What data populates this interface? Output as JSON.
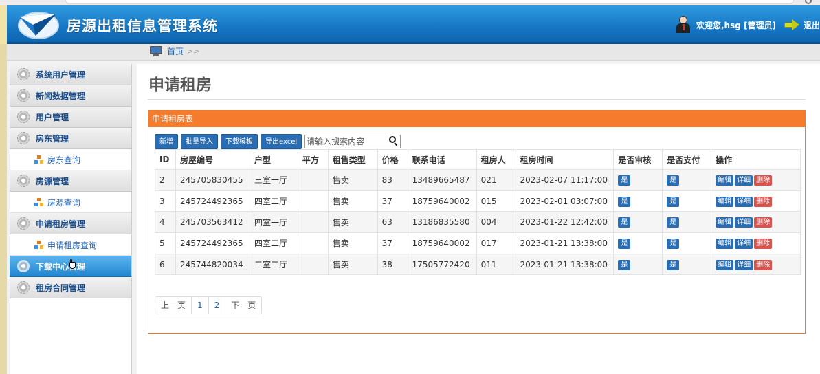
{
  "app": {
    "title": "房源出租信息管理系统"
  },
  "header": {
    "welcome": "欢迎您,hsg [管理员]",
    "logout_label": "退出"
  },
  "breadcrumb": {
    "home": "首页",
    "separator": ">>"
  },
  "sidebar": {
    "items": [
      {
        "label": "系统用户管理",
        "type": "menu"
      },
      {
        "label": "新闻数据管理",
        "type": "menu"
      },
      {
        "label": "用户管理",
        "type": "menu"
      },
      {
        "label": "房东管理",
        "type": "menu"
      },
      {
        "label": "房东查询",
        "type": "sub"
      },
      {
        "label": "房源管理",
        "type": "menu"
      },
      {
        "label": "房源查询",
        "type": "sub"
      },
      {
        "label": "申请租房管理",
        "type": "menu"
      },
      {
        "label": "申请租房查询",
        "type": "sub"
      },
      {
        "label": "下载中心管理",
        "type": "menu",
        "active": true
      },
      {
        "label": "租房合同管理",
        "type": "menu"
      }
    ]
  },
  "main": {
    "page_title": "申请租房",
    "panel_title": "申请租房表",
    "toolbar": {
      "add": "新增",
      "batch_import": "批量导入",
      "download_template": "下载模板",
      "export_excel": "导出excel",
      "search_placeholder": "请输入搜索内容"
    },
    "table": {
      "columns": [
        "ID",
        "房屋编号",
        "户型",
        "平方",
        "租售类型",
        "价格",
        "联系电话",
        "租房人",
        "租房时间",
        "是否审核",
        "是否支付",
        "操作"
      ],
      "rows": [
        {
          "id": "2",
          "house_no": "245705830455",
          "layout": "三室一厅",
          "area": "",
          "type": "售卖",
          "price": "83",
          "phone": "13489665487",
          "renter": "021",
          "time": "2023-02-07 11:17:00",
          "audited": "是",
          "paid": "是"
        },
        {
          "id": "3",
          "house_no": "245724492365",
          "layout": "四室二厅",
          "area": "",
          "type": "售卖",
          "price": "37",
          "phone": "18759640002",
          "renter": "015",
          "time": "2023-02-01 03:07:00",
          "audited": "是",
          "paid": "是"
        },
        {
          "id": "4",
          "house_no": "245703563412",
          "layout": "四室一厅",
          "area": "",
          "type": "售卖",
          "price": "63",
          "phone": "13186835580",
          "renter": "004",
          "time": "2023-01-22 12:42:00",
          "audited": "是",
          "paid": "是"
        },
        {
          "id": "5",
          "house_no": "245724492365",
          "layout": "四室二厅",
          "area": "",
          "type": "售卖",
          "price": "37",
          "phone": "18759640002",
          "renter": "017",
          "time": "2023-01-21 13:38:00",
          "audited": "是",
          "paid": "是"
        },
        {
          "id": "6",
          "house_no": "245744820034",
          "layout": "二室二厅",
          "area": "",
          "type": "售卖",
          "price": "38",
          "phone": "17505772420",
          "renter": "011",
          "time": "2023-01-21 13:38:00",
          "audited": "是",
          "paid": "是"
        }
      ],
      "actions": {
        "edit": "编辑",
        "detail": "详细",
        "delete": "删除"
      }
    },
    "pager": {
      "prev": "上一页",
      "pages": [
        "1",
        "2"
      ],
      "next": "下一页"
    }
  },
  "colors": {
    "header_blue": "#1676c4",
    "panel_orange": "#f47c2c",
    "button_blue": "#2a6db3",
    "delete_red": "#d9534f"
  }
}
